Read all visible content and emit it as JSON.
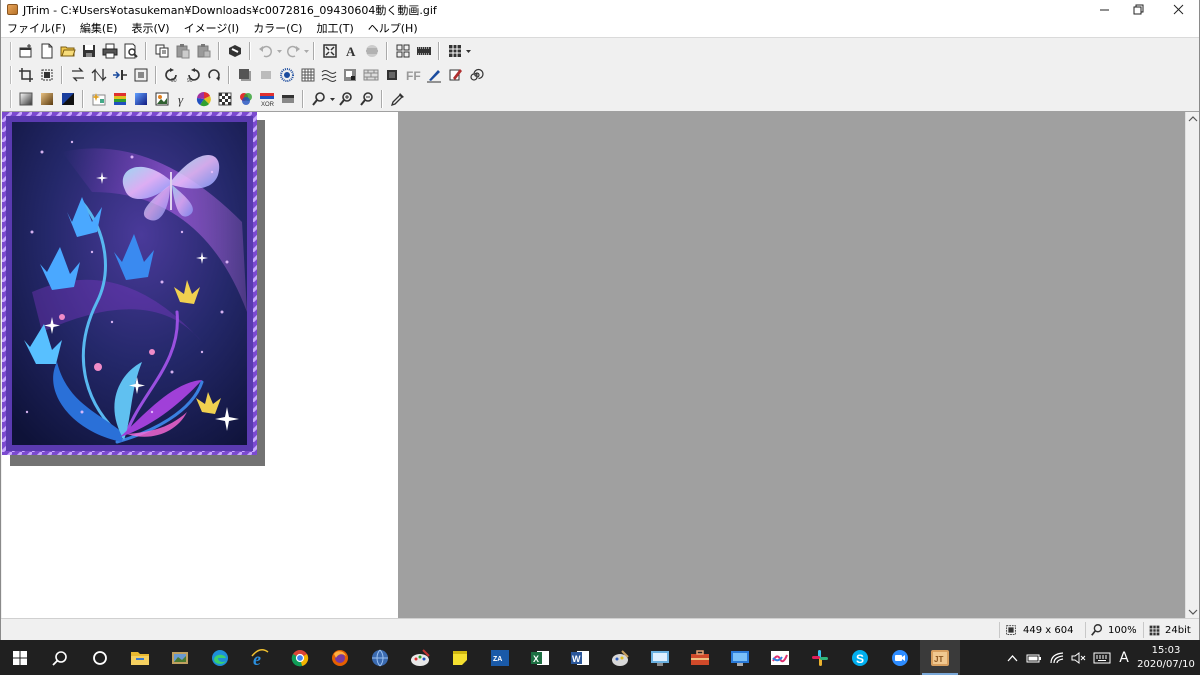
{
  "window": {
    "title": "JTrim - C:¥Users¥otasukeman¥Downloads¥c0072816_09430604動く動画.gif",
    "min_icon": "minimize-icon",
    "restore_icon": "restore-icon",
    "close_icon": "close-icon"
  },
  "menu": [
    "ファイル(F)",
    "編集(E)",
    "表示(V)",
    "イメージ(I)",
    "カラー(C)",
    "加工(T)",
    "ヘルプ(H)"
  ],
  "toolbar1": [
    "new-window-icon",
    "new-icon",
    "open-icon",
    "save-icon",
    "print-icon",
    "print-preview-icon",
    "copy-icon",
    "paste-icon",
    "paste-new-icon",
    "batch-icon",
    "undo-icon",
    "redo-icon",
    "fit-icon",
    "text-icon",
    "frame-icon",
    "tile-icon",
    "strip-icon",
    "grid-menu-icon"
  ],
  "toolbar2": [
    "crop-icon",
    "resize-icon",
    "flip-h-icon",
    "flip-v-icon",
    "mirror-icon",
    "canvas-icon",
    "rotate-left-icon",
    "rotate-right-icon",
    "rotate-icon",
    "shadow-icon",
    "border-icon",
    "sunburst-icon",
    "mosaic-icon",
    "wave-icon",
    "emboss-icon",
    "brick-icon",
    "square-icon",
    "ff-icon",
    "pen-icon",
    "eraser-icon",
    "spiral-icon"
  ],
  "toolbar3": [
    "gradient-icon",
    "sepia-icon",
    "contrast-icon",
    "sparkle-icon",
    "color-bars-icon",
    "blue-gradient-icon",
    "photo-icon",
    "gamma-icon",
    "color-wheel-icon",
    "checker-icon",
    "rgb-icon",
    "xor-icon",
    "gray-bar-icon",
    "zoom-menu-icon",
    "zoom-in-icon",
    "zoom-out-icon",
    "eyedropper-icon"
  ],
  "status": {
    "size": "449 x 604",
    "zoom": "100%",
    "depth": "24bit"
  },
  "taskbar": {
    "apps": [
      "windows-start-icon",
      "search-icon",
      "task-view-icon",
      "file-explorer-icon",
      "photos-icon",
      "edge-icon",
      "internet-explorer-icon",
      "chrome-icon",
      "firefox-icon",
      "globe-icon",
      "paint-icon",
      "sticky-notes-icon",
      "mail-app-icon",
      "excel-icon",
      "word-icon",
      "paint-palette-icon",
      "monitor-app-icon",
      "briefcase-icon",
      "remote-desktop-icon",
      "whiteboard-icon",
      "slack-icon",
      "skype-icon",
      "zoom-icon",
      "jtrim-icon"
    ],
    "time": "15:03",
    "date": "2020/07/10",
    "ime": "A"
  }
}
